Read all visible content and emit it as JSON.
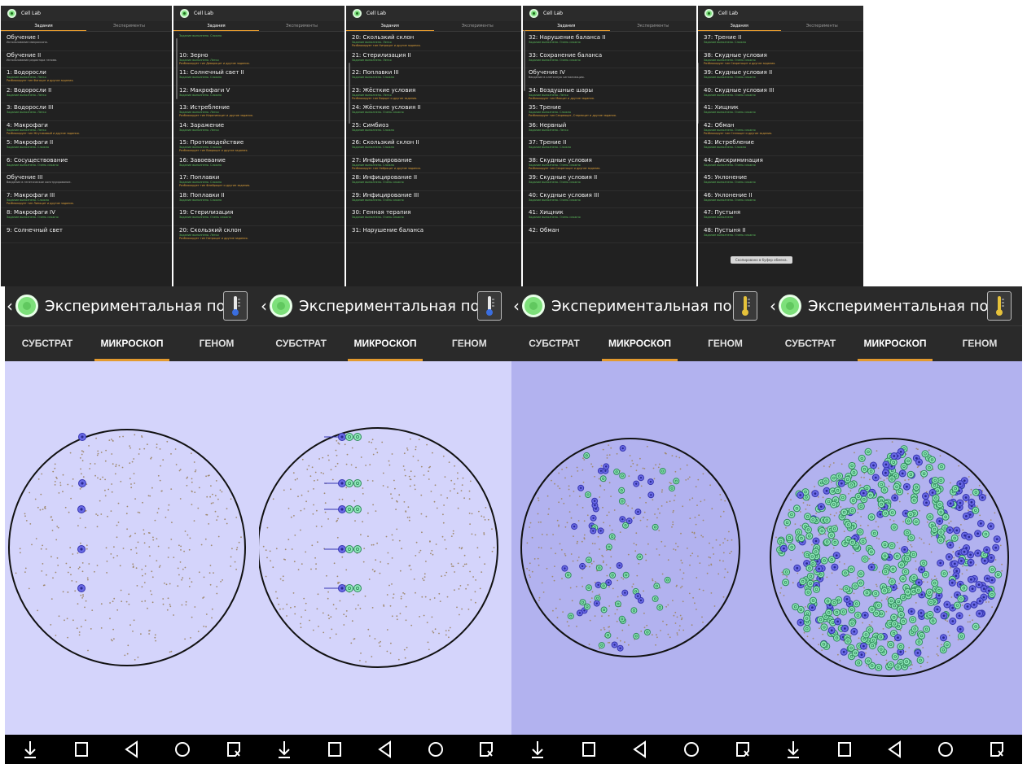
{
  "colors": {
    "accent": "#e39a2e",
    "done": "#5cbf5c",
    "unlocks": "#e0a23a",
    "panel_bg": "#212121",
    "dish_light": "#d4d4fb",
    "dish_dark": "#b2b2ef",
    "cell_blue": "#5050d8",
    "cell_green": "#67d9a3"
  },
  "app": {
    "title": "Cell Lab",
    "tabs": [
      "Задания",
      "Эксперименты"
    ]
  },
  "panels": [
    {
      "items": [
        {
          "title": "Обучение I",
          "lines": [
            {
              "t": "Использование микроскопа.",
              "c": "gy"
            }
          ]
        },
        {
          "title": "Обучение II",
          "lines": [
            {
              "t": "Использование редактора генома.",
              "c": "gy"
            }
          ]
        },
        {
          "title": "1: Водоросли",
          "lines": [
            {
              "t": "Задание выполнено. Легко",
              "c": "gr"
            },
            {
              "t": "Разблокирует тип Фагоцит и другие задания.",
              "c": "or"
            }
          ]
        },
        {
          "title": "2: Водоросли II",
          "lines": [
            {
              "t": "Задание выполнено. Легко",
              "c": "gr"
            }
          ]
        },
        {
          "title": "3: Водоросли III",
          "lines": [
            {
              "t": "Задание выполнено. Легко",
              "c": "gr"
            }
          ]
        },
        {
          "title": "4: Макрофаги",
          "lines": [
            {
              "t": "Задание выполнено. Легко",
              "c": "gr"
            },
            {
              "t": "Разблокирует тип Жгутиковый и другие задания.",
              "c": "or"
            }
          ]
        },
        {
          "title": "5: Макрофаги II",
          "lines": [
            {
              "t": "Задание выполнено. Сложно",
              "c": "gr"
            }
          ]
        },
        {
          "title": "6: Сосуществование",
          "lines": [
            {
              "t": "Задание выполнено. Очень сложно",
              "c": "gr"
            }
          ]
        },
        {
          "title": "Обучение III",
          "lines": [
            {
              "t": "Введение в генетическое конструирование.",
              "c": "gy"
            }
          ]
        },
        {
          "title": "7: Макрофаги III",
          "lines": [
            {
              "t": "Задание выполнено. Сложно",
              "c": "gr"
            },
            {
              "t": "Разблокирует тип Липоцит и другие задания.",
              "c": "or"
            }
          ]
        },
        {
          "title": "8: Макрофаги IV",
          "lines": [
            {
              "t": "Задание выполнено. Очень сложно",
              "c": "gr"
            }
          ]
        },
        {
          "title": "9: Солнечный свет",
          "lines": []
        }
      ]
    },
    {
      "items": [
        {
          "title": "",
          "lines": [
            {
              "t": "Задание выполнено. Сложно",
              "c": "gr"
            }
          ]
        },
        {
          "title": "10: Зерно",
          "lines": [
            {
              "t": "Задание выполнено. Легко",
              "c": "gr"
            },
            {
              "t": "Разблокирует тип Девороцит и другие задания.",
              "c": "or"
            }
          ]
        },
        {
          "title": "11: Солнечный свет II",
          "lines": [
            {
              "t": "Задание выполнено. Сложно",
              "c": "gr"
            }
          ]
        },
        {
          "title": "12: Макрофаги V",
          "lines": [
            {
              "t": "Задание выполнено. Сложно",
              "c": "gr"
            }
          ]
        },
        {
          "title": "13: Истребление",
          "lines": [
            {
              "t": "Задание выполнено. Легко",
              "c": "gr"
            },
            {
              "t": "Разблокирует тип Кератиноцит и другие задания.",
              "c": "or"
            }
          ]
        },
        {
          "title": "14: Заражение",
          "lines": [
            {
              "t": "Задание выполнено. Легко",
              "c": "gr"
            }
          ]
        },
        {
          "title": "15: Противодействие",
          "lines": [
            {
              "t": "Задание выполнено. Сложно",
              "c": "gr"
            },
            {
              "t": "Разблокирует тип Виороцит и другие задания.",
              "c": "or"
            }
          ]
        },
        {
          "title": "16: Завоевание",
          "lines": [
            {
              "t": "Задание выполнено. Сложно",
              "c": "gr"
            }
          ]
        },
        {
          "title": "17: Поплавки",
          "lines": [
            {
              "t": "Задание выполнено. Сложно",
              "c": "gr"
            },
            {
              "t": "Разблокирует тип Флейроцит и другие задания.",
              "c": "or"
            }
          ]
        },
        {
          "title": "18: Поплавки II",
          "lines": [
            {
              "t": "Задание выполнено. Сложно",
              "c": "gr"
            }
          ]
        },
        {
          "title": "19: Стерилизация",
          "lines": [
            {
              "t": "Задание выполнено. Очень сложно",
              "c": "gr"
            }
          ]
        },
        {
          "title": "20: Скользкий склон",
          "lines": [
            {
              "t": "Задание выполнено. Легко",
              "c": "gr"
            },
            {
              "t": "Разблокирует тип Нитроцит и другие задания.",
              "c": "or"
            }
          ]
        }
      ]
    },
    {
      "items": [
        {
          "title": "20: Скользкий склон",
          "lines": [
            {
              "t": "Задание выполнено. Легко",
              "c": "gr"
            },
            {
              "t": "Разблокирует тип Нитроцит и другие задания.",
              "c": "or"
            }
          ]
        },
        {
          "title": "21: Стерилизация II",
          "lines": [
            {
              "t": "Задание выполнено. Легко",
              "c": "gr"
            }
          ]
        },
        {
          "title": "22: Поплавки III",
          "lines": [
            {
              "t": "Задание выполнено. Сложно",
              "c": "gr"
            }
          ]
        },
        {
          "title": "23: Жёсткие условия",
          "lines": [
            {
              "t": "Задание выполнено. Легко",
              "c": "gr"
            },
            {
              "t": "Разблокирует тип Вирцит и другие задания.",
              "c": "or"
            }
          ]
        },
        {
          "title": "24: Жёсткие условия II",
          "lines": [
            {
              "t": "Задание выполнено. Очень сложно",
              "c": "gr"
            }
          ]
        },
        {
          "title": "25: Симбиоз",
          "lines": [
            {
              "t": "Задание выполнено. Сложно",
              "c": "gr"
            }
          ]
        },
        {
          "title": "26: Скользкий склон II",
          "lines": [
            {
              "t": "Задание выполнено. Сложно",
              "c": "gr"
            }
          ]
        },
        {
          "title": "27: Инфицирование",
          "lines": [
            {
              "t": "Задание выполнено. Сложно",
              "c": "gr"
            },
            {
              "t": "Разблокирует тип Нейроцит и другие задания.",
              "c": "or"
            }
          ]
        },
        {
          "title": "28: Инфицирование II",
          "lines": [
            {
              "t": "Задание выполнено. Очень сложно",
              "c": "gr"
            }
          ]
        },
        {
          "title": "29: Инфицирование III",
          "lines": [
            {
              "t": "Задание выполнено. Очень сложно",
              "c": "gr"
            }
          ]
        },
        {
          "title": "30: Генная терапия",
          "lines": [
            {
              "t": "Задание выполнено. Очень сложно",
              "c": "gr"
            }
          ]
        },
        {
          "title": "31: Нарушение баланса",
          "lines": []
        }
      ]
    },
    {
      "items": [
        {
          "title": "32: Нарушение баланса II",
          "lines": [
            {
              "t": "Задание выполнено. Очень сложно",
              "c": "gr"
            }
          ]
        },
        {
          "title": "33: Сохранение баланса",
          "lines": [
            {
              "t": "Задание выполнено. Очень сложно",
              "c": "gr"
            }
          ]
        },
        {
          "title": "Обучение IV",
          "lines": [
            {
              "t": "Введение в клеточную сигнализацию.",
              "c": "gy"
            }
          ]
        },
        {
          "title": "34: Воздушные шары",
          "lines": [
            {
              "t": "Задание выполнено. Легко",
              "c": "gr"
            },
            {
              "t": "Разблокирует тип Миоцит и другие задания.",
              "c": "or"
            }
          ]
        },
        {
          "title": "35: Трение",
          "lines": [
            {
              "t": "Задание выполнено. Сложно",
              "c": "gr"
            },
            {
              "t": "Разблокирует тип Секреоцит, Стереоцит и другие задания.",
              "c": "or"
            }
          ]
        },
        {
          "title": "36: Нервный",
          "lines": [
            {
              "t": "Задание выполнено. Легко",
              "c": "gr"
            }
          ]
        },
        {
          "title": "37: Трение II",
          "lines": [
            {
              "t": "Задание выполнено. Сложно",
              "c": "gr"
            }
          ]
        },
        {
          "title": "38: Скудные условия",
          "lines": [
            {
              "t": "Задание выполнено. Очень сложно",
              "c": "gr"
            },
            {
              "t": "Разблокирует тип Секретоцит и другие задания.",
              "c": "or"
            }
          ]
        },
        {
          "title": "39: Скудные условия II",
          "lines": [
            {
              "t": "Задание выполнено. Очень сложно",
              "c": "gr"
            }
          ]
        },
        {
          "title": "40: Скудные условия III",
          "lines": [
            {
              "t": "Задание выполнено. Очень сложно",
              "c": "gr"
            }
          ]
        },
        {
          "title": "41: Хищник",
          "lines": [
            {
              "t": "Задание выполнено. Очень сложно",
              "c": "gr"
            }
          ]
        },
        {
          "title": "42: Обман",
          "lines": []
        }
      ]
    },
    {
      "items": [
        {
          "title": "37: Трение II",
          "lines": [
            {
              "t": "Задание выполнено. Сложно",
              "c": "gr"
            }
          ]
        },
        {
          "title": "38: Скудные условия",
          "lines": [
            {
              "t": "Задание выполнено. Очень сложно",
              "c": "gr"
            },
            {
              "t": "Разблокирует тип Секретоцит и другие задания.",
              "c": "or"
            }
          ]
        },
        {
          "title": "39: Скудные условия II",
          "lines": [
            {
              "t": "Задание выполнено. Очень сложно",
              "c": "gr"
            }
          ]
        },
        {
          "title": "40: Скудные условия III",
          "lines": [
            {
              "t": "Задание выполнено. Очень сложно",
              "c": "gr"
            }
          ]
        },
        {
          "title": "41: Хищник",
          "lines": [
            {
              "t": "Задание выполнено. Очень сложно",
              "c": "gr"
            }
          ]
        },
        {
          "title": "42: Обман",
          "lines": [
            {
              "t": "Задание выполнено. Очень сложно",
              "c": "gr"
            },
            {
              "t": "Разблокирует тип Стелоцит и другие задания.",
              "c": "or"
            }
          ]
        },
        {
          "title": "43: Истребление",
          "lines": [
            {
              "t": "Задание выполнено. Сложно",
              "c": "gr"
            }
          ]
        },
        {
          "title": "44: Дискриминация",
          "lines": [
            {
              "t": "Задание выполнено. Очень сложно",
              "c": "gr"
            }
          ]
        },
        {
          "title": "45: Уклонение",
          "lines": [
            {
              "t": "Задание выполнено. Очень сложно",
              "c": "gr"
            }
          ]
        },
        {
          "title": "46: Уклонение II",
          "lines": [
            {
              "t": "Задание выполнено. Очень сложно",
              "c": "gr"
            }
          ]
        },
        {
          "title": "47: Пустыня",
          "lines": [
            {
              "t": "Задание выполнено",
              "c": "gr"
            }
          ]
        },
        {
          "title": "48: Пустыня II",
          "lines": [
            {
              "t": "Задание выполнено. Очень сложно",
              "c": "gr"
            }
          ]
        }
      ]
    }
  ],
  "toast": "Скопировано в буфер обмена.",
  "sim": {
    "title": "Экспериментальная поверхн",
    "back": "‹",
    "tabs": [
      "СУБСТРАТ",
      "МИКРОСКОП",
      "ГЕНОМ"
    ],
    "active_tab": "МИКРОСКОП",
    "nav_icons": [
      "download-icon",
      "square-icon",
      "triangle-back-icon",
      "circle-home-icon",
      "screenshot-icon"
    ]
  }
}
